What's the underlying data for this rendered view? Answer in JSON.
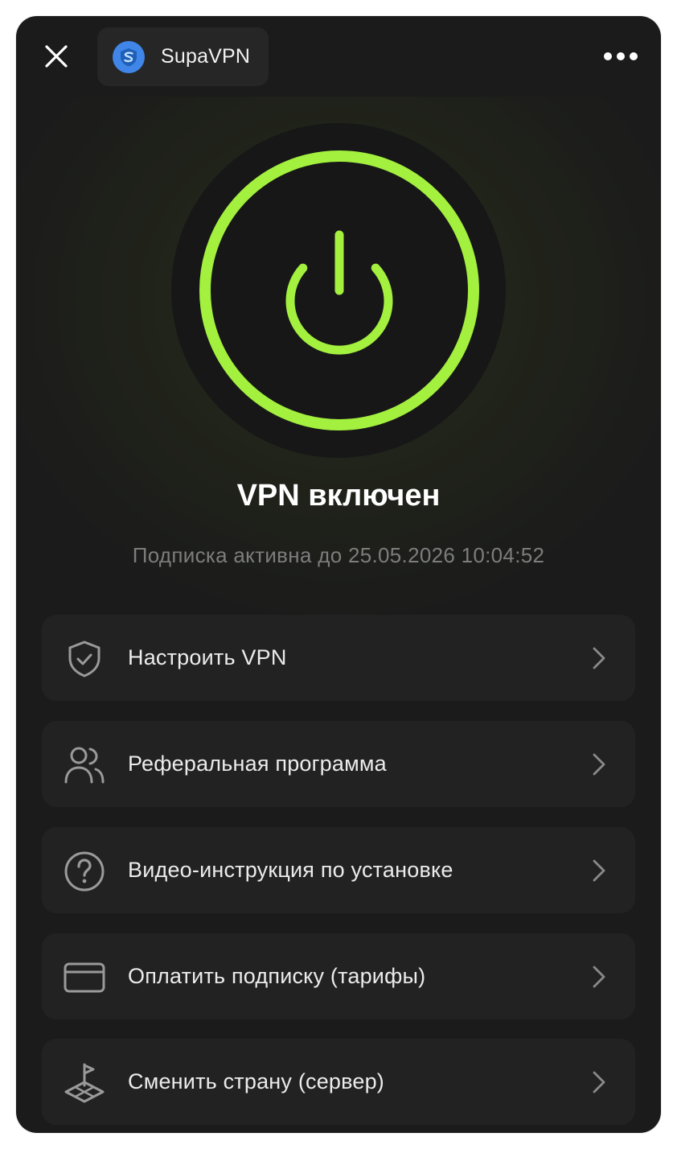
{
  "header": {
    "app_name": "SupaVPN",
    "logo_icon": "shield-s-icon",
    "accent_color": "#3f86e8"
  },
  "power": {
    "state": "on",
    "ring_color": "#a3f03f"
  },
  "status": {
    "title": "VPN включен",
    "subtitle": "Подписка активна до 25.05.2026 10:04:52"
  },
  "menu": {
    "items": [
      {
        "label": "Настроить VPN",
        "icon": "shield-check-icon"
      },
      {
        "label": "Реферальная программа",
        "icon": "users-icon"
      },
      {
        "label": "Видео-инструкция по установке",
        "icon": "help-circle-icon"
      },
      {
        "label": "Оплатить подписку (тарифы)",
        "icon": "credit-card-icon"
      },
      {
        "label": "Сменить страну (сервер)",
        "icon": "location-flag-icon"
      }
    ]
  }
}
